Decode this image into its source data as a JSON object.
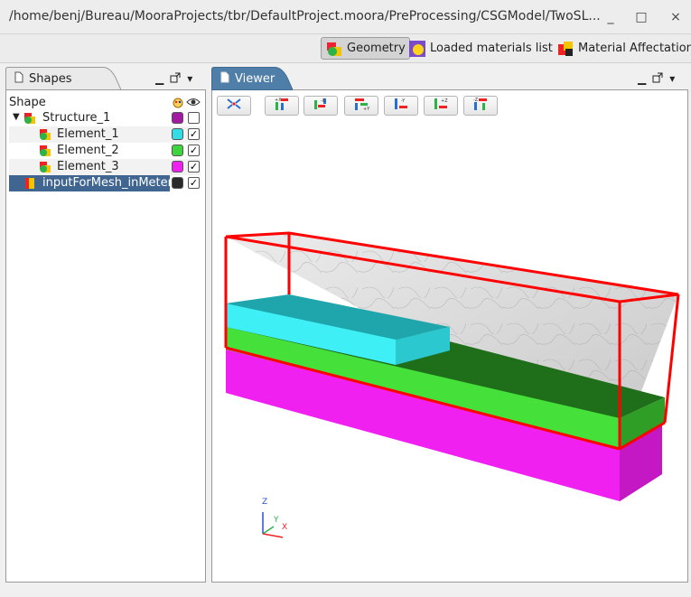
{
  "window": {
    "title": "/home/benj/Bureau/MooraProjects/tbr/DefaultProject.moora/PreProcessing/CSGModel/TwoSL...",
    "controls": [
      "_",
      "□",
      "×"
    ]
  },
  "perspectives": [
    {
      "label": "Geometry",
      "icon": "geometry-icon",
      "active": true
    },
    {
      "label": "Loaded materials list",
      "icon": "materials-icon",
      "active": false
    },
    {
      "label": "Material Affectation",
      "icon": "affectation-icon",
      "active": false
    }
  ],
  "shapes_panel": {
    "tab_label": "Shapes",
    "column_shape": "Shape",
    "rows": [
      {
        "label": "Structure_1",
        "color": "#a21aa2",
        "checked": false,
        "expanded": true,
        "level": 0
      },
      {
        "label": "Element_1",
        "color": "#33dde6",
        "checked": true,
        "level": 1
      },
      {
        "label": "Element_2",
        "color": "#3fd43f",
        "checked": true,
        "level": 1
      },
      {
        "label": "Element_3",
        "color": "#ee22ee",
        "checked": true,
        "level": 1
      },
      {
        "label": "inputForMesh_inMeter",
        "color": "#2a2a2a",
        "checked": true,
        "level": 0,
        "selected": true
      }
    ]
  },
  "viewer_panel": {
    "tab_label": "Viewer",
    "toolbar": [
      {
        "label": "fit",
        "icon": "fit-all-icon"
      },
      {
        "label": "+X",
        "icon": "view-plus-x-icon"
      },
      {
        "label": "-X",
        "icon": "view-minus-x-icon"
      },
      {
        "label": "+Y",
        "icon": "view-plus-y-icon"
      },
      {
        "label": "-Y",
        "icon": "view-minus-y-icon"
      },
      {
        "label": "+Z",
        "icon": "view-plus-z-icon"
      },
      {
        "label": "-Z",
        "icon": "view-minus-z-icon"
      }
    ],
    "triad": {
      "z": "Z",
      "y": "Y",
      "x": "X"
    }
  },
  "colors": {
    "cyan": "#3ef0f5",
    "green": "#46e03a",
    "magenta": "#f020f0",
    "bbox": "#ff0000",
    "selection": "#3f6590"
  }
}
